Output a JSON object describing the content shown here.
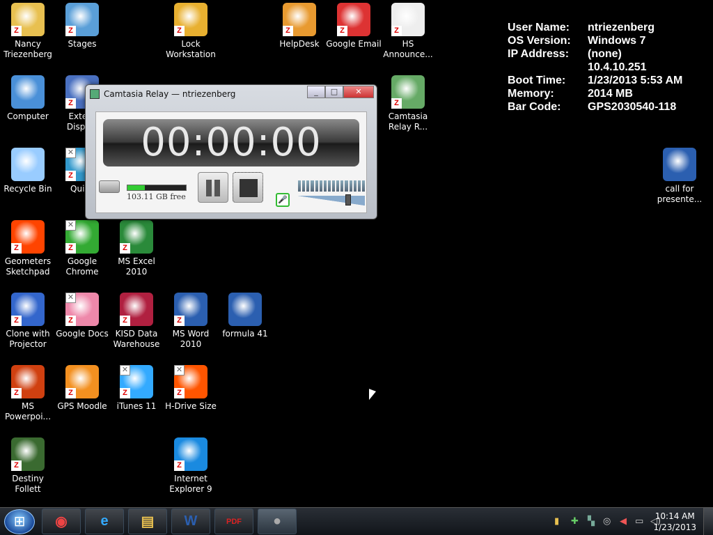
{
  "desktop_icons": [
    {
      "label": "Nancy Triezenberg",
      "icon": "user-folder-icon",
      "color": "#e8c050"
    },
    {
      "label": "Stages",
      "icon": "stages-icon",
      "color": "#5a9fd8"
    },
    {
      "label": "Lock Workstation",
      "icon": "lock-icon",
      "color": "#e8b030"
    },
    {
      "label": "HelpDesk",
      "icon": "helpdesk-icon",
      "color": "#e89a30"
    },
    {
      "label": "Google Email",
      "icon": "gmail-icon",
      "color": "#d33"
    },
    {
      "label": "HS Announce...",
      "icon": "announce-icon",
      "color": "#eee"
    },
    {
      "label": "Computer",
      "icon": "computer-icon",
      "color": "#4a90d8"
    },
    {
      "label": "Extern Display",
      "icon": "display-icon",
      "color": "#4a70c0"
    },
    {
      "label": "Camtasia Relay R...",
      "icon": "camtasia-relay-icon",
      "color": "#6a6"
    },
    {
      "label": "Recycle Bin",
      "icon": "recycle-bin-icon",
      "color": "#9cf"
    },
    {
      "label": "Quick",
      "icon": "quick-icon",
      "color": "#39c"
    },
    {
      "label": "call for presente...",
      "icon": "word-doc-icon",
      "color": "#2b5fb0"
    },
    {
      "label": "Geometers Sketchpad",
      "icon": "sketchpad-icon",
      "color": "#f40"
    },
    {
      "label": "Google Chrome",
      "icon": "chrome-icon",
      "color": "#3a3"
    },
    {
      "label": "MS Excel 2010",
      "icon": "excel-icon",
      "color": "#2a8a3a"
    },
    {
      "label": "Clone with Projector",
      "icon": "clone-icon",
      "color": "#36c"
    },
    {
      "label": "Google Docs",
      "icon": "docs-icon",
      "color": "#e8a"
    },
    {
      "label": "KISD Data Warehouse",
      "icon": "warehouse-icon",
      "color": "#b02040"
    },
    {
      "label": "MS Word 2010",
      "icon": "word-icon",
      "color": "#2b5fb0"
    },
    {
      "label": "formula 41",
      "icon": "word-doc-icon",
      "color": "#2b5fb0"
    },
    {
      "label": "MS Powerpoi...",
      "icon": "powerpoint-icon",
      "color": "#d04010"
    },
    {
      "label": "GPS Moodle",
      "icon": "moodle-icon",
      "color": "#f39020"
    },
    {
      "label": "iTunes 11",
      "icon": "itunes-icon",
      "color": "#3af"
    },
    {
      "label": "H-Drive Size",
      "icon": "pie-chart-icon",
      "color": "#f50"
    },
    {
      "label": "Destiny Follett",
      "icon": "tree-icon",
      "color": "#3a6a30"
    },
    {
      "label": "Internet Explorer 9",
      "icon": "ie-icon",
      "color": "#1a8ae0"
    }
  ],
  "bginfo": {
    "rows": [
      {
        "key": "User Name:",
        "value": "ntriezenberg"
      },
      {
        "key": "OS Version:",
        "value": "Windows 7"
      },
      {
        "key": "IP Address:",
        "value": "(none)"
      },
      {
        "key": "",
        "value": "10.4.10.251"
      },
      {
        "key": "Boot Time:",
        "value": "1/23/2013 5:53 AM"
      },
      {
        "key": "Memory:",
        "value": "2014 MB"
      },
      {
        "key": "Bar Code:",
        "value": "GPS2030540-118"
      }
    ]
  },
  "camtasia": {
    "title": "Camtasia Relay — ntriezenberg",
    "minimize": "_",
    "maximize": "□",
    "close": "✕",
    "timer": "00:00:00",
    "disk_free": "103.11 GB free",
    "disk_free_fraction": 0.3,
    "mic_icon": "microphone-icon",
    "volume_level": 0.75
  },
  "taskbar": {
    "apps": [
      {
        "name": "chrome",
        "glyph": "◉",
        "color": "#e44"
      },
      {
        "name": "internet-explorer",
        "glyph": "e",
        "color": "#3af"
      },
      {
        "name": "explorer",
        "glyph": "▤",
        "color": "#e8c050"
      },
      {
        "name": "word",
        "glyph": "W",
        "color": "#2b5fb0"
      },
      {
        "name": "pdf",
        "glyph": "PDF",
        "color": "#d22"
      },
      {
        "name": "camtasia-relay",
        "glyph": "●",
        "color": "#aaa"
      }
    ],
    "clock_time": "10:14 AM",
    "clock_date": "1/23/2013"
  }
}
